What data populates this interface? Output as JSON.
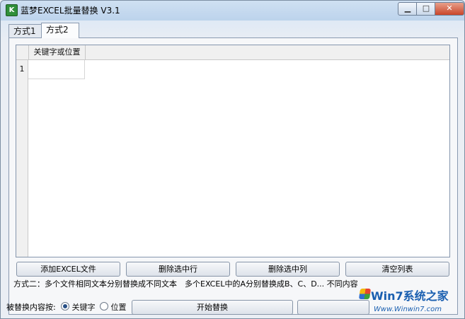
{
  "window": {
    "title": "蓝梦EXCEL批量替换 V3.1",
    "app_icon": "excel-app-icon",
    "min_label": "▁",
    "max_label": "□",
    "close_label": "✕"
  },
  "tabs": [
    {
      "label": "方式1",
      "active": false
    },
    {
      "label": "方式2",
      "active": true
    }
  ],
  "grid": {
    "columns": [
      "关键字或位置"
    ],
    "rows": [
      {
        "num": "1",
        "value": ""
      }
    ]
  },
  "buttons": {
    "add_excel": "添加EXCEL文件",
    "delete_row": "删除选中行",
    "delete_col": "删除选中列",
    "clear_list": "清空列表",
    "start_replace": "开始替换"
  },
  "description": "方式二：多个文件相同文本分别替换成不同文本　多个EXCEL中的A分别替换成B、C、D... 不同内容",
  "replace_by": {
    "label": "被替换内容按:",
    "options": [
      {
        "label": "关键字",
        "selected": true
      },
      {
        "label": "位置",
        "selected": false
      }
    ]
  },
  "watermark": {
    "title": "Win7系统之家",
    "url": "Www.Winwin7.com"
  }
}
